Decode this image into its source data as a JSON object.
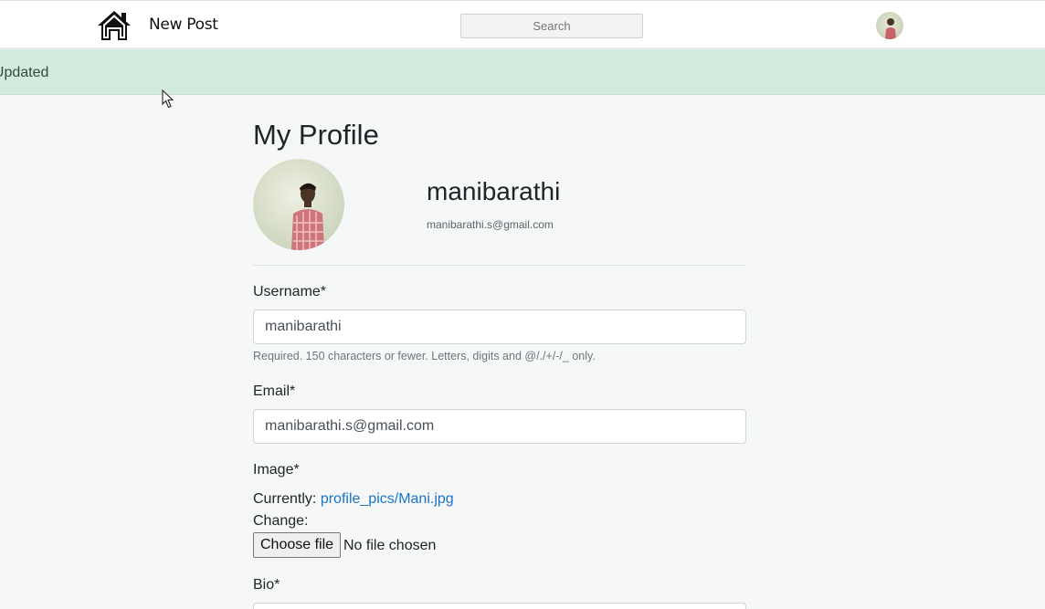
{
  "nav": {
    "new_post": "New Post",
    "search_placeholder": "Search"
  },
  "alert": {
    "message": "fully Updated"
  },
  "profile": {
    "title": "My Profile",
    "username": "manibarathi",
    "email": "manibarathi.s@gmail.com"
  },
  "form": {
    "username_label": "Username*",
    "username_value": "manibarathi",
    "username_help": "Required. 150 characters or fewer. Letters, digits and @/./+/-/_ only.",
    "email_label": "Email*",
    "email_value": "manibarathi.s@gmail.com",
    "image_label": "Image*",
    "currently_label": "Currently:",
    "current_image": "profile_pics/Mani.jpg",
    "change_label": "Change:",
    "choose_file": "Choose file",
    "no_file": "No file chosen",
    "bio_label": "Bio*"
  },
  "colors": {
    "alert_bg": "#d3ebdc",
    "link": "#1a73c8",
    "page_bg": "#f6f8f7"
  },
  "icons": [
    "home-icon",
    "cursor-pointer-icon"
  ]
}
